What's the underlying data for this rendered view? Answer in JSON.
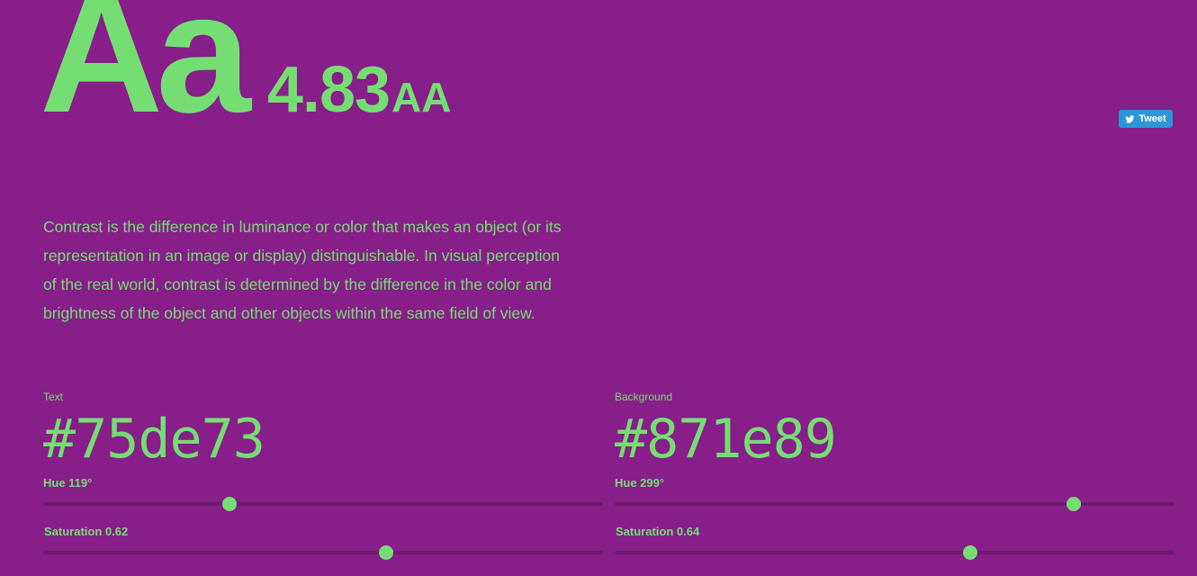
{
  "colors": {
    "text": "#75de73",
    "background": "#871e89",
    "tweet": "#2b96d8"
  },
  "hero": {
    "sample": "Aa",
    "ratio": "4.83",
    "level": "AA"
  },
  "tweet": {
    "label": "Tweet",
    "icon": "twitter-bird-icon"
  },
  "description": "Contrast is the difference in luminance or color that makes an object (or its representation in an image or display) distinguishable. In visual perception of the real world, contrast is determined by the difference in the color and brightness of the object and other objects within the same field of view.",
  "text_color": {
    "label": "Text",
    "hex": "#75de73",
    "hue_label": "Hue 119°",
    "hue": 119,
    "saturation_label": "Saturation 0.62",
    "saturation": 0.62
  },
  "background_color": {
    "label": "Background",
    "hex": "#871e89",
    "hue_label": "Hue 299°",
    "hue": 299,
    "saturation_label": "Saturation 0.64",
    "saturation": 0.64
  }
}
